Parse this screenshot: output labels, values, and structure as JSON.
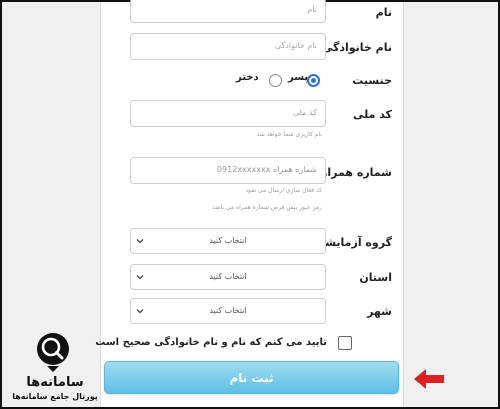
{
  "form": {
    "first_name": {
      "label": "نام",
      "placeholder": "نام"
    },
    "last_name": {
      "label": "نام خانوادگی",
      "placeholder": "نام خانوادگی"
    },
    "gender": {
      "label": "جنسیت",
      "options": [
        "پسر",
        "دختر"
      ],
      "selected": "پسر"
    },
    "national_id": {
      "label": "کد ملی",
      "placeholder": "کد ملی",
      "help": "نام کاربری شما خواهد شد"
    },
    "mobile": {
      "label": "شماره همراه",
      "placeholder": "شماره همراه 0912xxxxxxx",
      "help_1": "کد فعال سازی ارسال می شود",
      "help_2": "رمز عبور پیش فرض شماره همراه می باشد"
    },
    "test_group": {
      "label": "گروه آزمایشی",
      "value": "انتخاب کنید"
    },
    "province": {
      "label": "استان",
      "value": "انتخاب کنید"
    },
    "city": {
      "label": "شهر",
      "value": "انتخاب کنید"
    },
    "confirm": {
      "label": "تایید می کنم که نام و نام خانوادگی صحیح است",
      "checked": false
    },
    "submit_label": "ثبت نام"
  },
  "watermark": {
    "title": "سامانه‌ها",
    "subtitle": "پورتال جامع سامانه‌ها",
    "icon": "magnifier-icon"
  },
  "annotation": {
    "icon": "arrow-pointer-icon",
    "color": "#e02020"
  },
  "colors": {
    "accent": "#2b6fd8",
    "button": "#5ebfe4"
  }
}
